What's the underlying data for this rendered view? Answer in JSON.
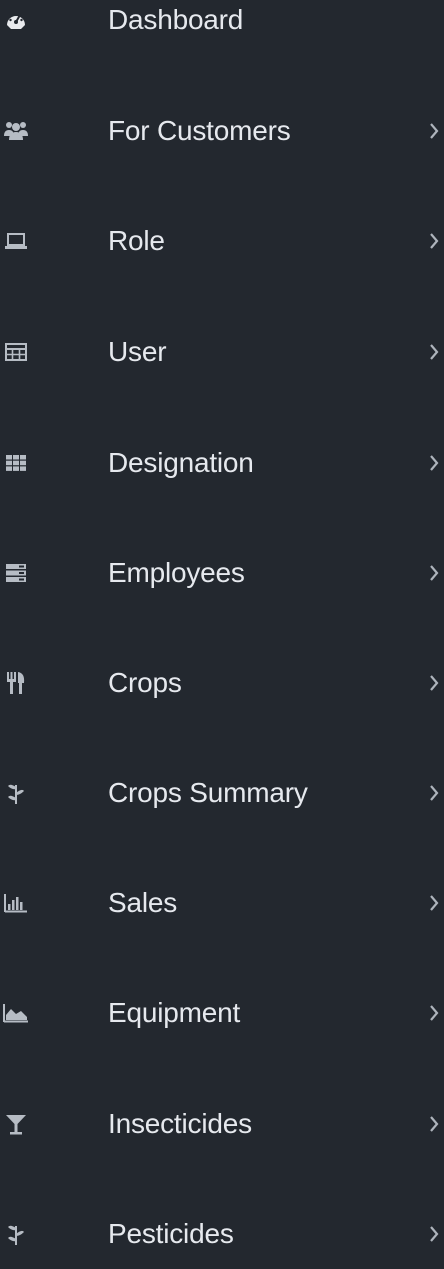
{
  "sidebar": {
    "items": [
      {
        "label": "Dashboard",
        "icon": "dashboard-icon",
        "has_submenu": false
      },
      {
        "label": "For Customers",
        "icon": "users-icon",
        "has_submenu": true
      },
      {
        "label": "Role",
        "icon": "laptop-icon",
        "has_submenu": true
      },
      {
        "label": "User",
        "icon": "table-icon",
        "has_submenu": true
      },
      {
        "label": "Designation",
        "icon": "grid-icon",
        "has_submenu": true
      },
      {
        "label": "Employees",
        "icon": "server-icon",
        "has_submenu": true
      },
      {
        "label": "Crops",
        "icon": "cutlery-icon",
        "has_submenu": true
      },
      {
        "label": "Crops Summary",
        "icon": "leaf-icon",
        "has_submenu": true
      },
      {
        "label": "Sales",
        "icon": "bar-chart-icon",
        "has_submenu": true
      },
      {
        "label": "Equipment",
        "icon": "area-chart-icon",
        "has_submenu": true
      },
      {
        "label": "Insecticides",
        "icon": "filter-icon",
        "has_submenu": true
      },
      {
        "label": "Pesticides",
        "icon": "leaf-icon",
        "has_submenu": true
      }
    ]
  },
  "colors": {
    "background": "#23282f",
    "text": "#e6e9ee",
    "icon": "#b6bcc4",
    "chevron": "#aeb4bc"
  }
}
